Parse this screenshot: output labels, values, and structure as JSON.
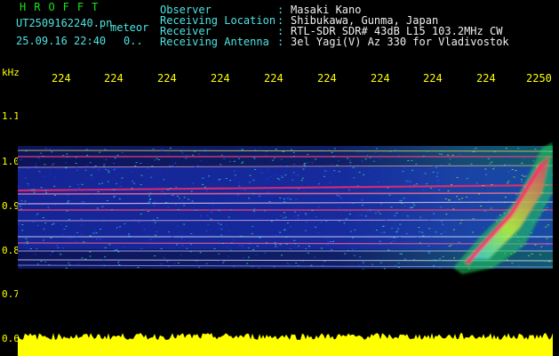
{
  "brand": "HROFFT",
  "filename": "UT2509162240.pn",
  "meteor_label": "meteor",
  "datetime": "25.09.16 22:40",
  "counter": "0..",
  "info": [
    {
      "label": "Observer",
      "sep": ":",
      "value": "Masaki Kano"
    },
    {
      "label": "Receiving Location",
      "sep": ":",
      "value": "Shibukawa, Gunma, Japan"
    },
    {
      "label": "Receiver",
      "sep": ":",
      "value": "RTL-SDR SDR# 43dB L15 103.2MHz CW"
    },
    {
      "label": "Receiving Antenna",
      "sep": ":",
      "value": "3el Yagi(V) Az 330 for Vladivostok"
    }
  ],
  "y_unit": "kHz",
  "y_ticks": [
    "1.1",
    "1.0",
    "0.9",
    "0.8",
    "0.7",
    "0.6"
  ],
  "x_ticks": [
    "224",
    "224",
    "224",
    "224",
    "224",
    "224",
    "224",
    "224",
    "224",
    "2250"
  ],
  "colors": {
    "text_label": "#4fe3e3",
    "tick": "#ffff00",
    "brand": "#19e219",
    "bg": "#000000"
  }
}
